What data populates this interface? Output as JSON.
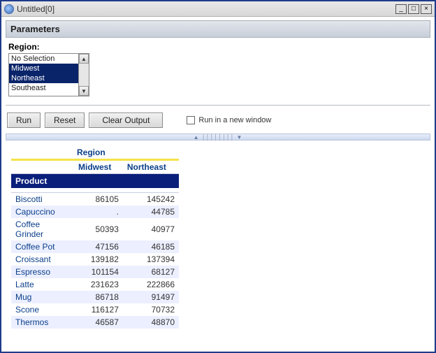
{
  "window": {
    "title": "Untitled[0]"
  },
  "parameters": {
    "header": "Parameters",
    "region_label": "Region:",
    "options": {
      "no_selection": "No Selection",
      "midwest": "Midwest",
      "northeast": "Northeast",
      "southeast": "Southeast"
    }
  },
  "toolbar": {
    "run": "Run",
    "reset": "Reset",
    "clear_output": "Clear Output",
    "run_new_window": "Run in a new window"
  },
  "report": {
    "region_header": "Region",
    "product_header": "Product",
    "columns": {
      "c1": "Midwest",
      "c2": "Northeast"
    },
    "rows": [
      {
        "name": "Biscotti",
        "c1": "86105",
        "c2": "145242"
      },
      {
        "name": "Capuccino",
        "c1": ".",
        "c2": "44785"
      },
      {
        "name": "Coffee Grinder",
        "c1": "50393",
        "c2": "40977"
      },
      {
        "name": "Coffee Pot",
        "c1": "47156",
        "c2": "46185"
      },
      {
        "name": "Croissant",
        "c1": "139182",
        "c2": "137394"
      },
      {
        "name": "Espresso",
        "c1": "101154",
        "c2": "68127"
      },
      {
        "name": "Latte",
        "c1": "231623",
        "c2": "222866"
      },
      {
        "name": "Mug",
        "c1": "86718",
        "c2": "91497"
      },
      {
        "name": "Scone",
        "c1": "116127",
        "c2": "70732"
      },
      {
        "name": "Thermos",
        "c1": "46587",
        "c2": "48870"
      }
    ]
  }
}
